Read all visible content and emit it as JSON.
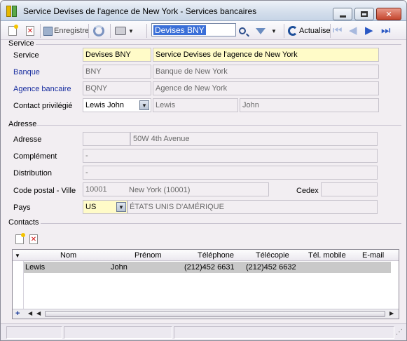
{
  "window": {
    "title": "Service Devises de l'agence de New York  -  Services bancaires"
  },
  "toolbar": {
    "save_label": "Enregistre",
    "search_value": "Devises BNY",
    "actualise_label": "Actualise"
  },
  "service_group": {
    "title": "Service",
    "service_label": "Service",
    "service_code": "Devises BNY",
    "service_name": "Service Devises de l'agence de New York",
    "banque_label": "Banque",
    "banque_code": "BNY",
    "banque_name": "Banque de New York",
    "agence_label": "Agence bancaire",
    "agence_code": "BQNY",
    "agence_name": "Agence de New York",
    "contact_label": "Contact privilégié",
    "contact_value": "Lewis John",
    "contact_lastname": "Lewis",
    "contact_firstname": "John"
  },
  "adresse_group": {
    "title": "Adresse",
    "adresse_label": "Adresse",
    "adresse_value": "50W 4th Avenue",
    "complement_label": "Complément",
    "complement_value": "-",
    "distribution_label": "Distribution",
    "distribution_value": "-",
    "cp_label": "Code postal - Ville",
    "cp_value": "10001",
    "ville_value": "New York (10001)",
    "cedex_label": "Cedex",
    "pays_label": "Pays",
    "pays_code": "US",
    "pays_name": "ÉTATS UNIS D'AMÉRIQUE"
  },
  "contacts_group": {
    "title": "Contacts",
    "columns": [
      "Nom",
      "Prénom",
      "Téléphone",
      "Télécopie",
      "Tél. mobile",
      "E-mail"
    ],
    "rows": [
      {
        "nom": "Lewis",
        "prenom": "John",
        "telephone": "(212)452 6631",
        "telecopie": "(212)452 6632",
        "mobile": "",
        "email": ""
      }
    ]
  },
  "icons": {
    "new": "new-document-icon",
    "delete": "delete-icon",
    "save": "save-icon",
    "refresh": "refresh-icon",
    "print": "print-icon",
    "search": "search-icon",
    "filter": "filter-icon",
    "actualise": "actualise-icon",
    "first": "first-record-icon",
    "prev": "previous-record-icon",
    "next": "next-record-icon",
    "last": "last-record-icon"
  }
}
